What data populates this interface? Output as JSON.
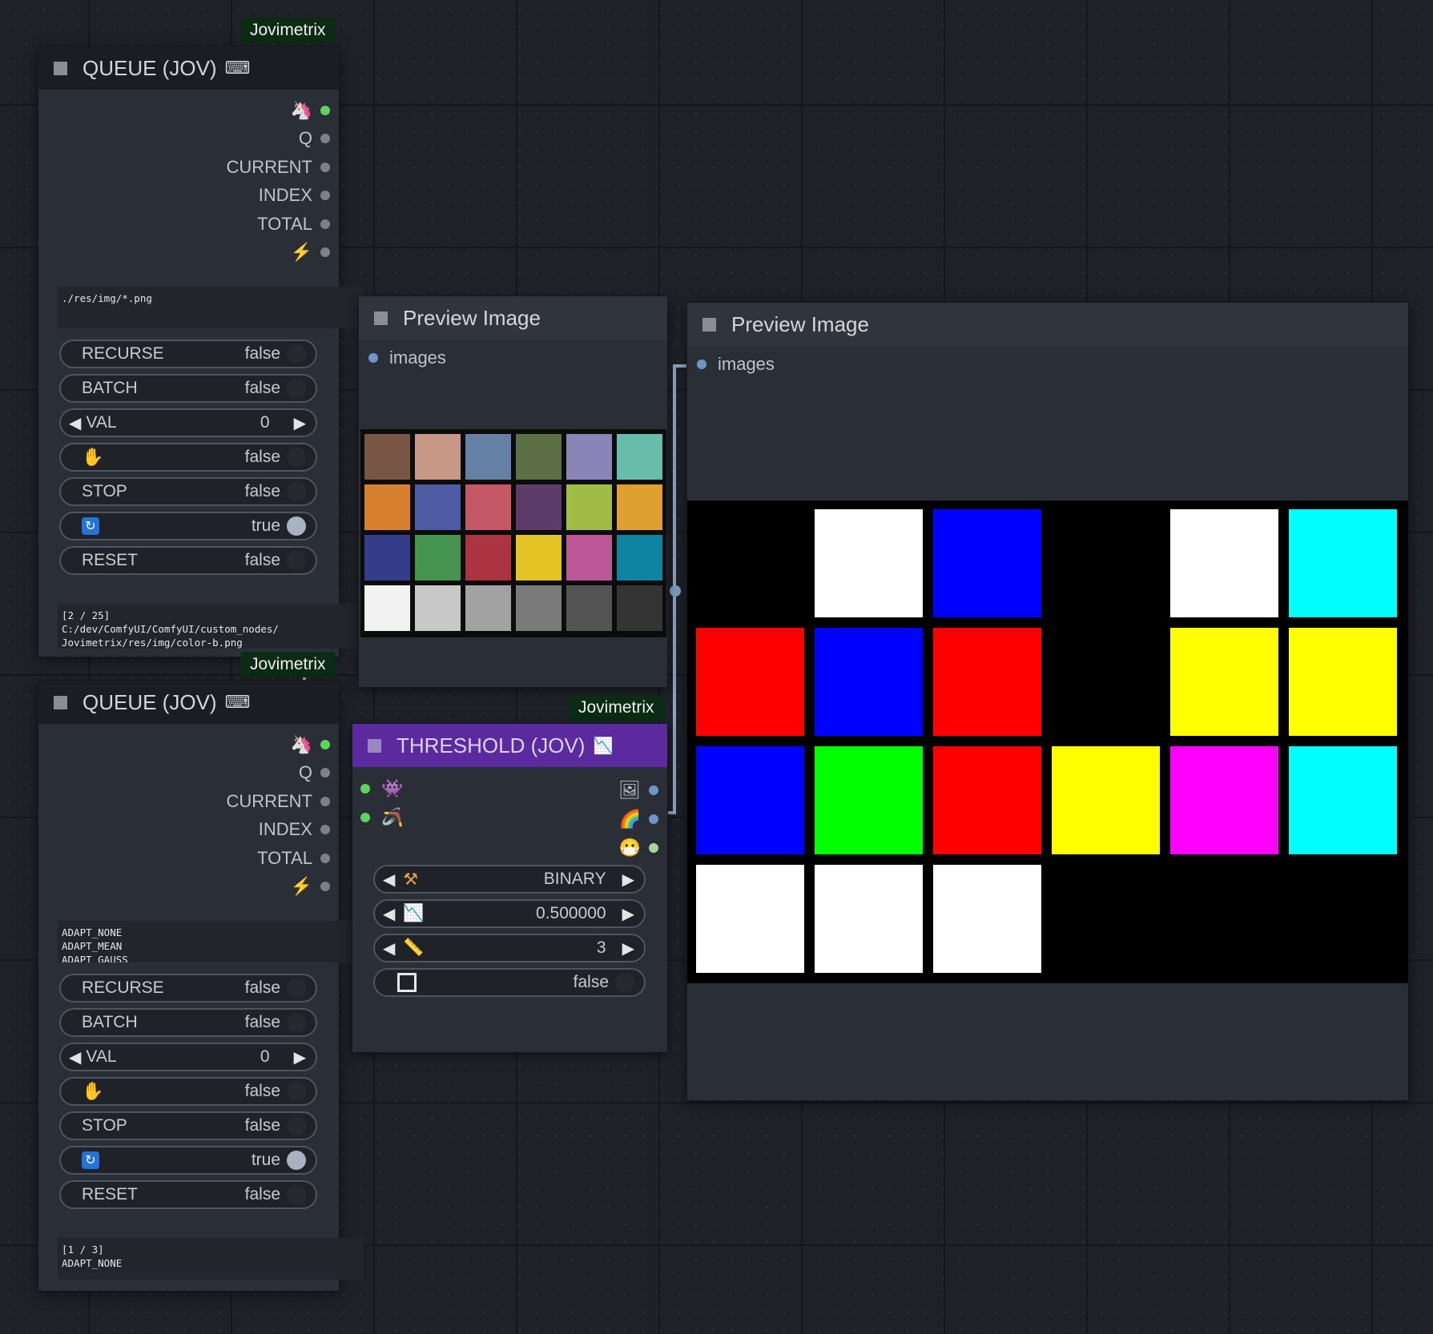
{
  "queue1": {
    "badge": "Jovimetrix",
    "title": "QUEUE (JOV)",
    "title_icon": "✔",
    "outputs": [
      {
        "label": "",
        "icon": "unicorn-icon"
      },
      {
        "label": "Q"
      },
      {
        "label": "CURRENT"
      },
      {
        "label": "INDEX"
      },
      {
        "label": "TOTAL"
      },
      {
        "label": "",
        "icon": "lightning-icon"
      }
    ],
    "path_text": "./res/img/*.png",
    "widgets": {
      "recurse": {
        "label": "RECURSE",
        "value": "false"
      },
      "batch": {
        "label": "BATCH",
        "value": "false"
      },
      "val": {
        "label": "VAL",
        "value": "0"
      },
      "hold": {
        "value": "false"
      },
      "stop": {
        "label": "STOP",
        "value": "false"
      },
      "loop": {
        "value": "true"
      },
      "reset": {
        "label": "RESET",
        "value": "false"
      }
    },
    "status_text": "[2 / 25]\nC:/dev/ComfyUI/ComfyUI/custom_nodes/\nJovimetrix/res/img/color-b.png"
  },
  "queue2": {
    "badge": "Jovimetrix",
    "title": "QUEUE (JOV)",
    "outputs": [
      {
        "label": "",
        "icon": "unicorn-icon"
      },
      {
        "label": "Q"
      },
      {
        "label": "CURRENT"
      },
      {
        "label": "INDEX"
      },
      {
        "label": "TOTAL"
      },
      {
        "label": "",
        "icon": "lightning-icon"
      }
    ],
    "path_text": "ADAPT_NONE\nADAPT_MEAN\nADAPT_GAUSS",
    "widgets": {
      "recurse": {
        "label": "RECURSE",
        "value": "false"
      },
      "batch": {
        "label": "BATCH",
        "value": "false"
      },
      "val": {
        "label": "VAL",
        "value": "0"
      },
      "hold": {
        "value": "false"
      },
      "stop": {
        "label": "STOP",
        "value": "false"
      },
      "loop": {
        "value": "true"
      },
      "reset": {
        "label": "RESET",
        "value": "false"
      }
    },
    "status_text": "[1 / 3]\nADAPT_NONE"
  },
  "preview1": {
    "title": "Preview Image",
    "input_label": "images",
    "swatches": [
      "#7a5444",
      "#c89886",
      "#6480a4",
      "#5c6e44",
      "#8a84b8",
      "#68bcaa",
      "#d8802e",
      "#4e5aa2",
      "#c45866",
      "#5e3c6a",
      "#a0bc44",
      "#e0a030",
      "#343c8c",
      "#449450",
      "#ac3440",
      "#e4c424",
      "#bc5898",
      "#0c84a2",
      "#f2f2f2",
      "#c8c8c8",
      "#a2a2a2",
      "#7a7a7a",
      "#545454",
      "#343434"
    ]
  },
  "preview2": {
    "title": "Preview Image",
    "input_label": "images",
    "cells": [
      "#000000",
      "#ffffff",
      "#0000ff",
      "#000000",
      "#ffffff",
      "#00ffff",
      "#ff0000",
      "#0000ff",
      "#ff0000",
      "#000000",
      "#ffff00",
      "#ffff00",
      "#0000ff",
      "#00ff00",
      "#ff0000",
      "#ffff00",
      "#ff00ff",
      "#00ffff",
      "#ffffff",
      "#ffffff",
      "#ffffff",
      "#000000",
      "#000000",
      "#000000"
    ]
  },
  "threshold": {
    "badge": "Jovimetrix",
    "title": "THRESHOLD (JOV)",
    "header_color": "#5b2a9e",
    "mode": {
      "value": "BINARY"
    },
    "threshold": {
      "value": "0.500000"
    },
    "block": {
      "value": "3"
    },
    "invert": {
      "value": "false"
    }
  },
  "colors": {
    "wire": "#8fa6c0",
    "badge_bg": "#0b2b14"
  }
}
